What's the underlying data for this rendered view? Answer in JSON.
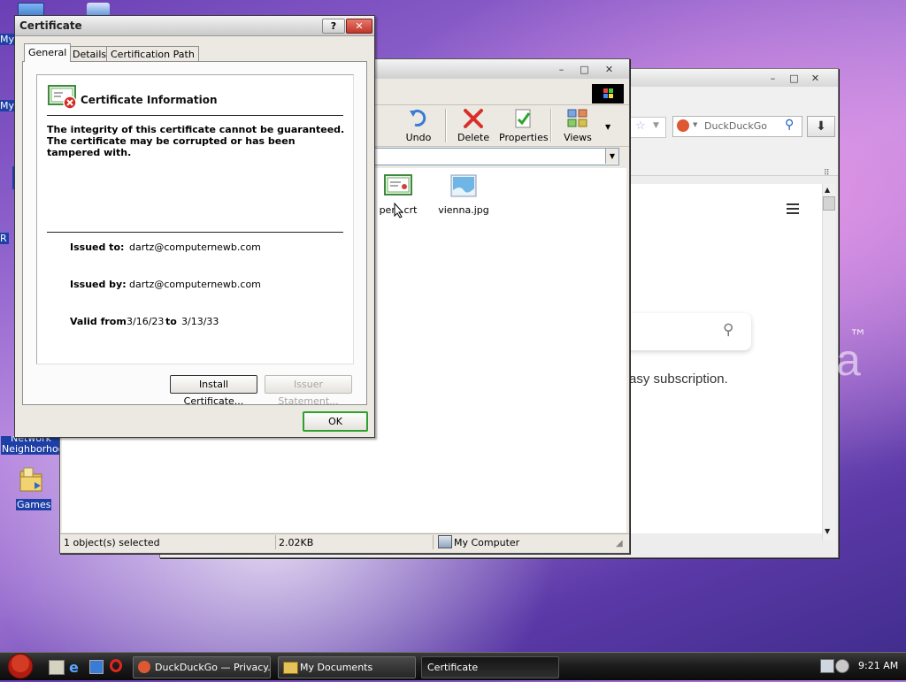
{
  "desktop": {
    "icons": [
      {
        "label": "My",
        "id": "my-1"
      },
      {
        "label": "My",
        "id": "my-2"
      },
      {
        "label": "R",
        "id": "r"
      },
      {
        "label": "Network\nNeighborhood",
        "id": "network"
      },
      {
        "label": "Games",
        "id": "games"
      }
    ],
    "network_label": "Network",
    "network_label2": "Neighborhood",
    "games_label": "Games"
  },
  "browser": {
    "search_placeholder": "DuckDuckGo",
    "page_text": "asy subscription.",
    "tm": "™",
    "big_letter": "a"
  },
  "explorer": {
    "toolbar": {
      "undo": "Undo",
      "delete": "Delete",
      "properties": "Properties",
      "views": "Views"
    },
    "files": [
      {
        "name": "pem.crt"
      },
      {
        "name": "vienna.jpg"
      }
    ],
    "status": {
      "selected": "1 object(s) selected",
      "size": "2.02KB",
      "location": "My Computer"
    }
  },
  "cert_dialog": {
    "title": "Certificate",
    "help_btn": "?",
    "close_btn": "✕",
    "tabs": [
      "General",
      "Details",
      "Certification Path"
    ],
    "heading": "Certificate Information",
    "warning_line1": "The integrity of this certificate cannot be guaranteed.",
    "warning_line2": "The certificate may be corrupted or has been",
    "warning_line3": "tampered with.",
    "issued_to_label": "Issued to:",
    "issued_to_value": "dartz@computernewb.com",
    "issued_by_label": "Issued by:",
    "issued_by_value": "dartz@computernewb.com",
    "valid_from_label": "Valid from",
    "valid_from_value": "3/16/23",
    "valid_to_label": "to",
    "valid_to_value": "3/13/33",
    "install_btn": "Install Certificate...",
    "issuer_btn": "Issuer Statement...",
    "ok_btn": "OK"
  },
  "taskbar": {
    "items": [
      {
        "label": "DuckDuckGo — Privacy...."
      },
      {
        "label": "My Documents"
      },
      {
        "label": "Certificate"
      }
    ],
    "clock": "9:21 AM"
  }
}
